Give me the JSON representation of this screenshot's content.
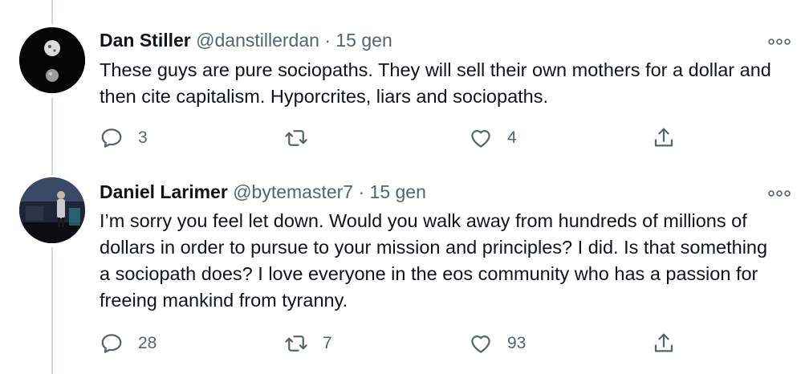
{
  "tweets": [
    {
      "name": "Dan Stiller",
      "handle": "@danstillerdan",
      "separator": "·",
      "time": "15 gen",
      "text": "These guys are pure sociopaths. They will sell their own mothers for a dollar and then cite capitalism. Hyporcrites, liars and sociopaths.",
      "replies": "3",
      "retweets": "",
      "likes": "4"
    },
    {
      "name": "Daniel Larimer",
      "handle": "@bytemaster7",
      "separator": "·",
      "time": "15 gen",
      "text": "I’m sorry you feel let down.  Would you walk away from hundreds of millions of dollars in order to pursue to your mission and principles? I did. Is that something a sociopath does? I love everyone in the eos community who has a passion for freeing mankind from tyranny.",
      "replies": "28",
      "retweets": "7",
      "likes": "93"
    }
  ],
  "icons": {
    "reply": "reply-icon",
    "retweet": "retweet-icon",
    "like": "heart-icon",
    "share": "share-icon",
    "more": "more-icon"
  },
  "colors": {
    "text": "#0f1419",
    "secondary": "#536471",
    "thread_line": "#cfd9de"
  }
}
